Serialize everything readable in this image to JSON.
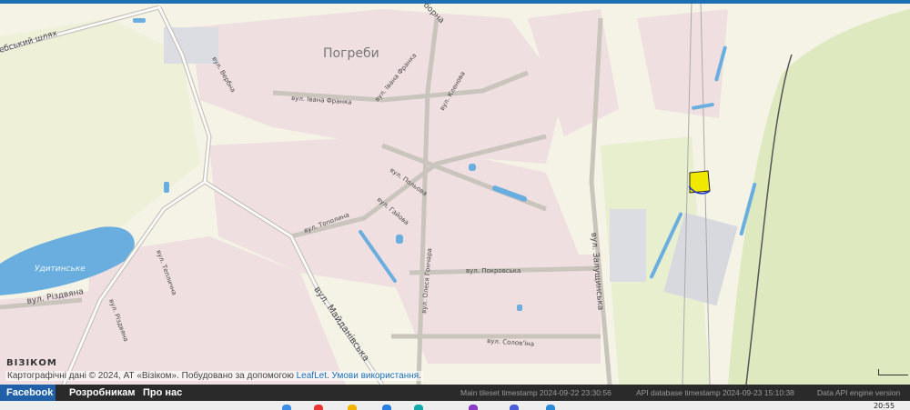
{
  "map": {
    "place_label": "Погреби",
    "lake_label": "Удитинське",
    "streets": {
      "shliakh": "ебський шлях",
      "zaborna": "борна",
      "verbna": "вул. Вербна",
      "ivana_franka": "вул. Івана Франка",
      "ivana_franka_2": "вул. Івана Франка",
      "klenova": "вул. Кленова",
      "polova": "вул. Польова",
      "haiova": "вул. Гайова",
      "topolyna": "вул. Тополина",
      "pokrovska": "вул. Покровська",
      "olesia_honchara": "вул. Олеся Гончара",
      "zaluzhynska": "вул. Залущинська",
      "maidanivska": "вул. Майданівська",
      "rizdviana": "вул. Різдвяна",
      "rizdviana_2": "вул. Різдвяна",
      "teplychna": "вул. Теплична",
      "solovina": "вул. Солов'їна"
    },
    "highlight_color": "#f0e800"
  },
  "attribution": {
    "logo": "ВІЗІКОМ",
    "text": "Картографічні дані © 2024, АТ «Візіком». Побудовано за допомогою ",
    "leaflet_link": "LeafLet",
    "terms_link": "Умови використання"
  },
  "footer": {
    "nav": [
      "Facebook",
      "Розробникам",
      "Про нас"
    ],
    "main_tileset": "Main tileset timestamp 2024-09-22 23:30:56",
    "api_db": "API database timestamp 2024-09-23 15:10:38",
    "engine": "Data API engine version"
  },
  "taskbar": {
    "clock": "20:55"
  }
}
